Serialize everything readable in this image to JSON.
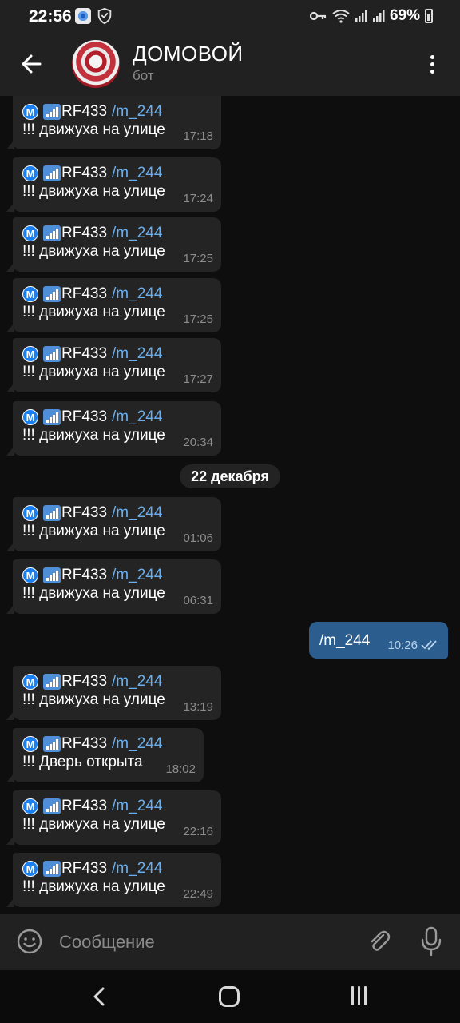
{
  "status_bar": {
    "time": "22:56",
    "battery": "69%",
    "icons": [
      "app-notification-icon",
      "shield-icon",
      "key-icon",
      "wifi-icon",
      "signal-icon",
      "signal-icon",
      "battery-icon"
    ]
  },
  "header": {
    "title": "ДОМОВОЙ",
    "subtitle": "бот",
    "back_icon": "arrow-left-icon",
    "menu_icon": "more-vert-icon"
  },
  "messages": [
    {
      "badge": "M",
      "source": "RF433",
      "command": "/m_244",
      "text": "!!! движуха на улице",
      "time": "17:18"
    },
    {
      "badge": "M",
      "source": "RF433",
      "command": "/m_244",
      "text": "!!! движуха на улице",
      "time": "17:24"
    },
    {
      "badge": "M",
      "source": "RF433",
      "command": "/m_244",
      "text": "!!! движуха на улице",
      "time": "17:25"
    },
    {
      "badge": "M",
      "source": "RF433",
      "command": "/m_244",
      "text": "!!! движуха на улице",
      "time": "17:25"
    },
    {
      "badge": "M",
      "source": "RF433",
      "command": "/m_244",
      "text": "!!! движуха на улице",
      "time": "17:27"
    },
    {
      "badge": "M",
      "source": "RF433",
      "command": "/m_244",
      "text": "!!! движуха на улице",
      "time": "20:34"
    },
    {
      "badge": "M",
      "source": "RF433",
      "command": "/m_244",
      "text": "!!! движуха на улице",
      "time": "01:06"
    },
    {
      "badge": "M",
      "source": "RF433",
      "command": "/m_244",
      "text": "!!! движуха на улице",
      "time": "06:31"
    },
    {
      "badge": "M",
      "source": "RF433",
      "command": "/m_244",
      "text": "!!! движуха на улице",
      "time": "13:19"
    },
    {
      "badge": "M",
      "source": "RF433",
      "command": "/m_244",
      "text": "!!! Дверь открыта",
      "time": "18:02"
    },
    {
      "badge": "M",
      "source": "RF433",
      "command": "/m_244",
      "text": "!!! движуха на улице",
      "time": "22:16"
    },
    {
      "badge": "M",
      "source": "RF433",
      "command": "/m_244",
      "text": "!!! движуха на улице",
      "time": "22:49"
    }
  ],
  "date_separator": "22 декабря",
  "outgoing": {
    "text": "/m_244",
    "time": "10:26",
    "status_icon": "double-check-icon"
  },
  "input": {
    "placeholder": "Сообщение"
  },
  "colors": {
    "accent": "#6ab0f0",
    "outgoing_bubble": "#2b5d8f",
    "incoming_bubble": "#242424",
    "background": "#0e0e0e"
  }
}
